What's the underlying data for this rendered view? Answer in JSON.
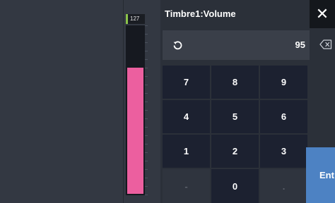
{
  "meter": {
    "max_label": "127",
    "value": 95,
    "max": 127,
    "fill_color": "#ec5f9f"
  },
  "dialog": {
    "title": "Timbre1:Volume",
    "value": "95",
    "icons": {
      "close": "close-icon",
      "undo": "undo-icon",
      "backspace": "backspace-icon"
    }
  },
  "keypad": {
    "keys": [
      "7",
      "8",
      "9",
      "4",
      "5",
      "6",
      "1",
      "2",
      "3",
      "-",
      "0",
      "."
    ],
    "enter_label": "Ent"
  },
  "colors": {
    "accent": "#4d82c3",
    "background": "#252a33",
    "key": "#1c2130"
  }
}
